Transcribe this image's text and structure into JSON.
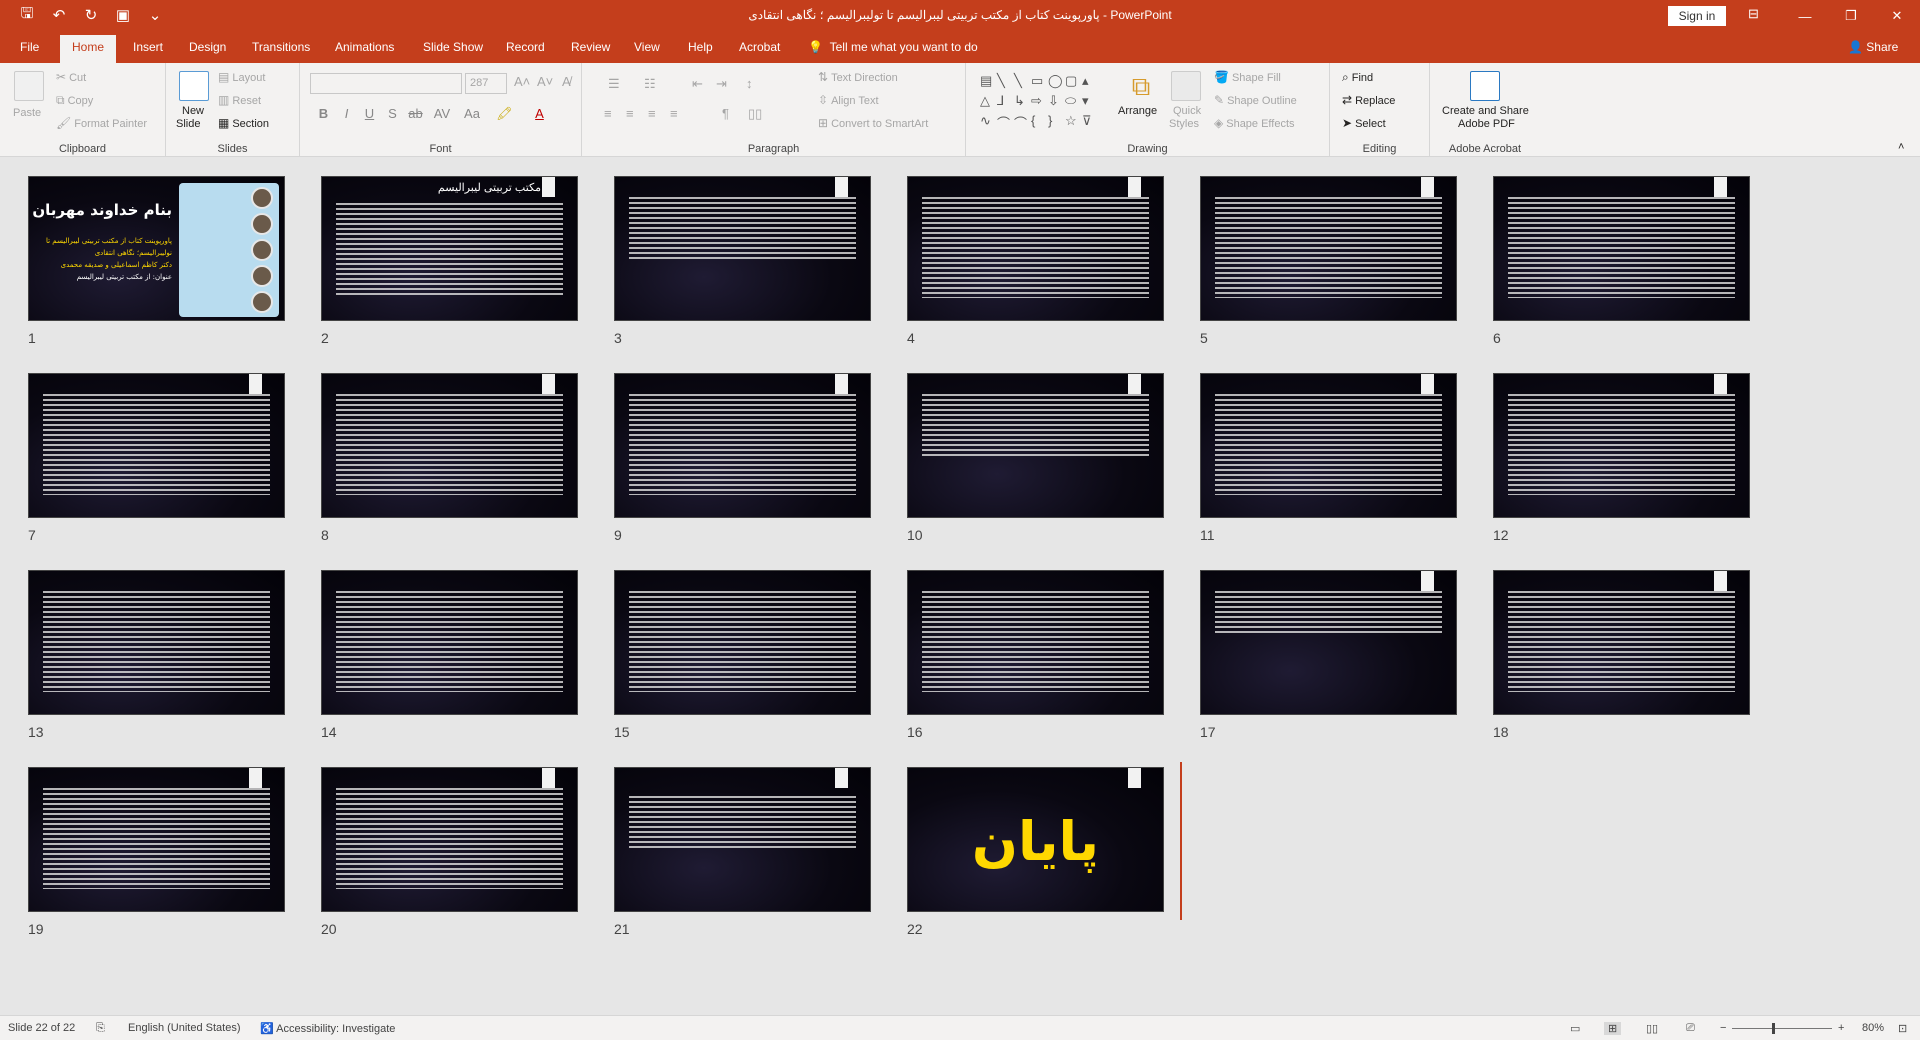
{
  "window": {
    "title": "پاورپوینت کتاب از مکتب تربیتی لیبرالیسم تا تولیبرالیسم ؛ نگاهی انتقادی  -  PowerPoint",
    "sign_in": "Sign in",
    "qat_icons": [
      "save-icon",
      "undo-icon",
      "redo-icon",
      "start-slideshow-icon",
      "customize-qat-icon"
    ]
  },
  "tabs": {
    "items": [
      "File",
      "Home",
      "Insert",
      "Design",
      "Transitions",
      "Animations",
      "Slide Show",
      "Record",
      "Review",
      "View",
      "Help",
      "Acrobat"
    ],
    "active": "Home",
    "tell_me": "Tell me what you want to do",
    "share": "Share"
  },
  "ribbon": {
    "clipboard": {
      "label": "Clipboard",
      "paste": "Paste",
      "cut": "Cut",
      "copy": "Copy",
      "format_painter": "Format Painter"
    },
    "slides": {
      "label": "Slides",
      "new_slide_1": "New",
      "new_slide_2": "Slide",
      "layout": "Layout",
      "reset": "Reset",
      "section": "Section"
    },
    "font": {
      "label": "Font",
      "font_name": "",
      "font_size": "287",
      "bold": "B",
      "italic": "I",
      "underline": "U",
      "strike": "S",
      "shadow": "ab",
      "spacing": "AV",
      "case": "Aa"
    },
    "paragraph": {
      "label": "Paragraph",
      "text_direction": "Text Direction",
      "align_text": "Align Text",
      "convert_smartart": "Convert to SmartArt"
    },
    "drawing": {
      "label": "Drawing",
      "arrange": "Arrange",
      "quick_styles_1": "Quick",
      "quick_styles_2": "Styles",
      "shape_fill": "Shape Fill",
      "shape_outline": "Shape Outline",
      "shape_effects": "Shape Effects"
    },
    "editing": {
      "label": "Editing",
      "find": "Find",
      "replace": "Replace",
      "select": "Select"
    },
    "acrobat": {
      "label": "Adobe Acrobat",
      "create_1": "Create and Share",
      "create_2": "Adobe PDF"
    }
  },
  "slides": {
    "numbers": [
      "1",
      "2",
      "3",
      "4",
      "5",
      "6",
      "7",
      "8",
      "9",
      "10",
      "11",
      "12",
      "13",
      "14",
      "15",
      "16",
      "17",
      "18",
      "19",
      "20",
      "21",
      "22"
    ],
    "slide1_title": "بنام خداوند مهربان",
    "slide1_lines": [
      "پاورپوینت کتاب از مکتب تربیتی لیبرالیسم تا",
      "نولیبرالیسم؛ نگاهی انتقادی",
      "دکتر کاظم اسماعیلی و صدیقه محمدی",
      "عنوان: از مکتب تربیتی لیبرالیسم"
    ],
    "slide2_heading": "مکتب تربیتی لیبرالیسم",
    "slide22_text": "پایان"
  },
  "status": {
    "slide_of": "Slide 22 of 22",
    "language": "English (United States)",
    "accessibility": "Accessibility: Investigate",
    "zoom": "80%"
  }
}
